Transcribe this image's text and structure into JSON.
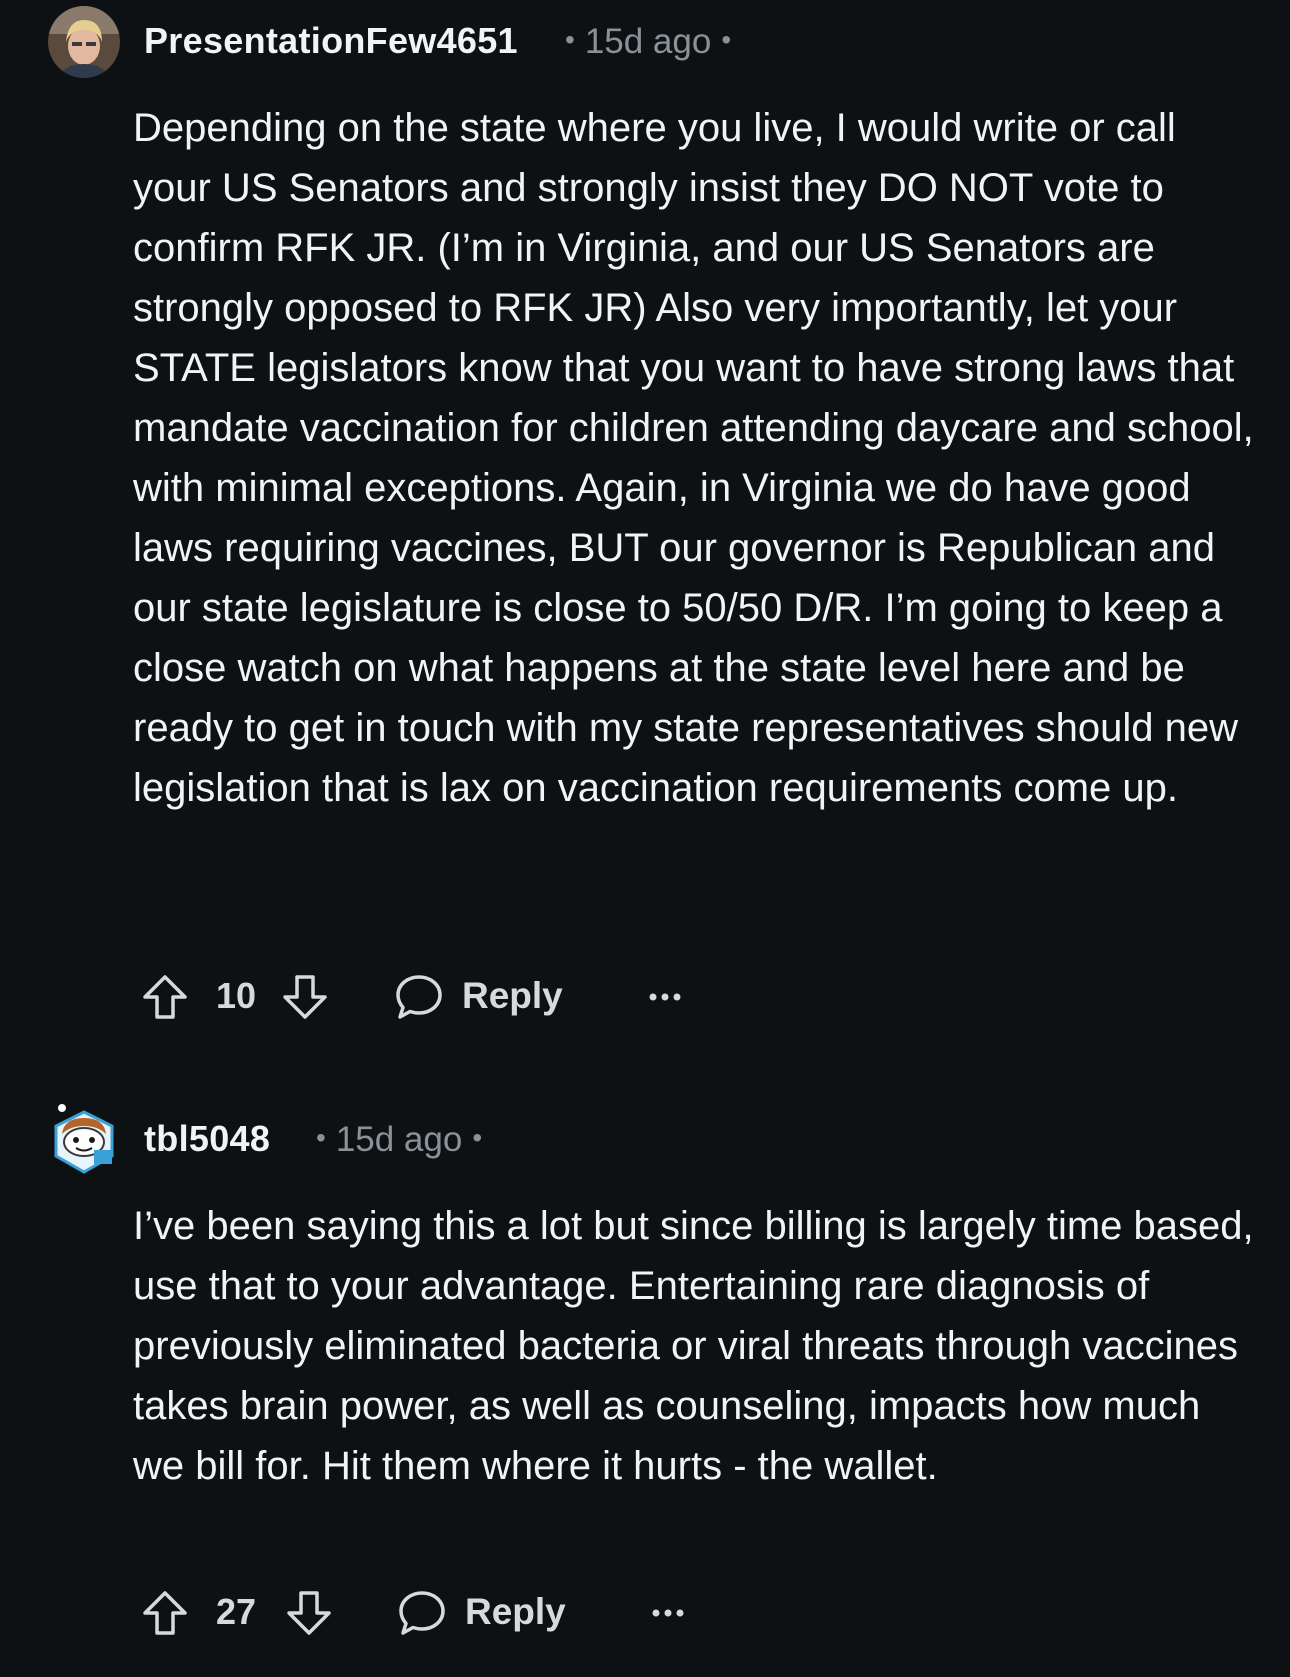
{
  "comments": [
    {
      "username": "PresentationFew4651",
      "time": "15d ago",
      "separator": "•",
      "body": "Depending on the state where you live, I would write or call your US Senators and strongly insist they DO NOT vote to confirm RFK JR. (I’m in Virginia, and our US Senators are strongly opposed to RFK JR) Also very importantly, let your STATE legislators know that you want to have strong laws that mandate vaccination for children attending daycare and school, with minimal exceptions. Again, in Virginia we do have good laws requiring vaccines, BUT our governor is Republican and our state legislature is close to 50/50 D/R. I’m going to keep a close watch on what happens at the state level here and be ready to get in touch with my state representatives should new legislation that is lax on vaccination requirements come up.",
      "score": "10",
      "reply_label": "Reply",
      "avatar_icon": "user-photo-avatar"
    },
    {
      "username": "tbl5048",
      "time": "15d ago",
      "separator": "•",
      "body": "I’ve been saying this a lot but since billing is largely time based, use that to your advantage. Entertaining rare diagnosis of previously eliminated bacteria or viral threats through vaccines takes brain power, as well as counseling, impacts how much we bill for. Hit them where it hurts - the wallet.",
      "score": "27",
      "reply_label": "Reply",
      "avatar_icon": "snoo-avatar"
    }
  ],
  "colors": {
    "background": "#0e1113",
    "text": "#f2f3f5",
    "meta": "#8b9297",
    "icons": "#d7dadc"
  }
}
